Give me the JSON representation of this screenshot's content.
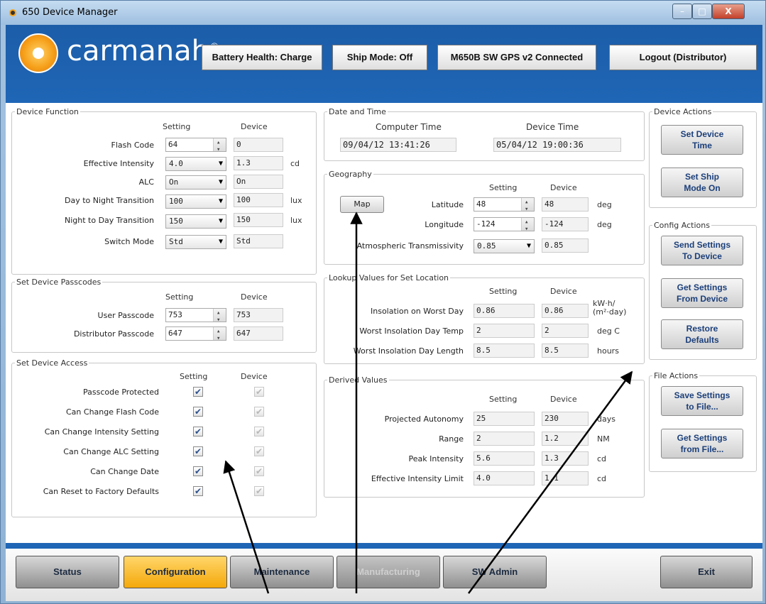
{
  "window": {
    "title": "650 Device Manager",
    "min_label": "–",
    "max_label": "□",
    "close_label": "X"
  },
  "header": {
    "brand": "carmanah",
    "brand_mark": "®",
    "battery": "Battery Health: Charge",
    "ship_mode": "Ship Mode: Off",
    "device": "M650B SW GPS v2 Connected",
    "logout": "Logout (Distributor)"
  },
  "device_function": {
    "title": "Device Function",
    "col_setting": "Setting",
    "col_device": "Device",
    "rows": [
      {
        "label": "Flash Code",
        "setting": "64",
        "device": "0",
        "unit": "",
        "control": "spin"
      },
      {
        "label": "Effective Intensity",
        "setting": "4.0",
        "device": "1.3",
        "unit": "cd",
        "control": "combo"
      },
      {
        "label": "ALC",
        "setting": "On",
        "device": "On",
        "unit": "",
        "control": "combo"
      },
      {
        "label": "Day to Night Transition",
        "setting": "100",
        "device": "100",
        "unit": "lux",
        "control": "combo"
      },
      {
        "label": "Night to Day Transition",
        "setting": "150",
        "device": "150",
        "unit": "lux",
        "control": "combo"
      },
      {
        "label": "Switch Mode",
        "setting": "Std",
        "device": "Std",
        "unit": "",
        "control": "combo"
      }
    ]
  },
  "passcodes": {
    "title": "Set Device Passcodes",
    "col_setting": "Setting",
    "col_device": "Device",
    "rows": [
      {
        "label": "User Passcode",
        "setting": "753",
        "device": "753"
      },
      {
        "label": "Distributor Passcode",
        "setting": "647",
        "device": "647"
      }
    ]
  },
  "access": {
    "title": "Set Device Access",
    "col_setting": "Setting",
    "col_device": "Device",
    "check_glyph": "✔",
    "rows": [
      {
        "label": "Passcode Protected"
      },
      {
        "label": "Can Change Flash Code"
      },
      {
        "label": "Can Change Intensity Setting"
      },
      {
        "label": "Can Change ALC Setting"
      },
      {
        "label": "Can Change Date"
      },
      {
        "label": "Can Reset to Factory Defaults"
      }
    ]
  },
  "datetime": {
    "title": "Date and Time",
    "computer_label": "Computer Time",
    "device_label": "Device Time",
    "computer_value": "09/04/12 13:41:26",
    "device_value": "05/04/12 19:00:36"
  },
  "geography": {
    "title": "Geography",
    "col_setting": "Setting",
    "col_device": "Device",
    "map_label": "Map",
    "rows": [
      {
        "label": "Latitude",
        "setting": "48",
        "device": "48",
        "unit": "deg"
      },
      {
        "label": "Longitude",
        "setting": "-124",
        "device": "-124",
        "unit": "deg"
      },
      {
        "label": "Atmospheric Transmissivity",
        "setting": "0.85",
        "device": "0.85",
        "unit": ""
      }
    ]
  },
  "lookup": {
    "title": "Lookup Values for Set Location",
    "col_setting": "Setting",
    "col_device": "Device",
    "rows": [
      {
        "label": "Insolation on Worst Day",
        "setting": "0.86",
        "device": "0.86",
        "unit": "kW·h/\n(m²·day)"
      },
      {
        "label": "Worst Insolation Day Temp",
        "setting": "2",
        "device": "2",
        "unit": "deg C"
      },
      {
        "label": "Worst Insolation Day Length",
        "setting": "8.5",
        "device": "8.5",
        "unit": "hours"
      }
    ]
  },
  "derived": {
    "title": "Derived Values",
    "col_setting": "Setting",
    "col_device": "Device",
    "rows": [
      {
        "label": "Projected Autonomy",
        "setting": "25",
        "device": "230",
        "unit": "days"
      },
      {
        "label": "Range",
        "setting": "2",
        "device": "1.2",
        "unit": "NM"
      },
      {
        "label": "Peak Intensity",
        "setting": "5.6",
        "device": "1.3",
        "unit": "cd"
      },
      {
        "label": "Effective Intensity Limit",
        "setting": "4.0",
        "device": "1.1",
        "unit": "cd"
      }
    ]
  },
  "device_actions": {
    "title": "Device Actions",
    "set_time": "Set Device\nTime",
    "ship_mode": "Set Ship\nMode On"
  },
  "config_actions": {
    "title": "Config Actions",
    "send": "Send Settings\nTo Device",
    "get": "Get Settings\nFrom Device",
    "restore": "Restore\nDefaults"
  },
  "file_actions": {
    "title": "File Actions",
    "save": "Save Settings\nto File...",
    "load": "Get Settings\nfrom File..."
  },
  "nav": {
    "status": "Status",
    "configuration": "Configuration",
    "maintenance": "Maintenance",
    "manufacturing": "Manufacturing",
    "sw_admin": "SW Admin",
    "exit": "Exit"
  },
  "colors": {
    "brand_blue": "#1f66b6",
    "active_tab": "#f4a80a",
    "label_blue": "#1b3f7a"
  }
}
